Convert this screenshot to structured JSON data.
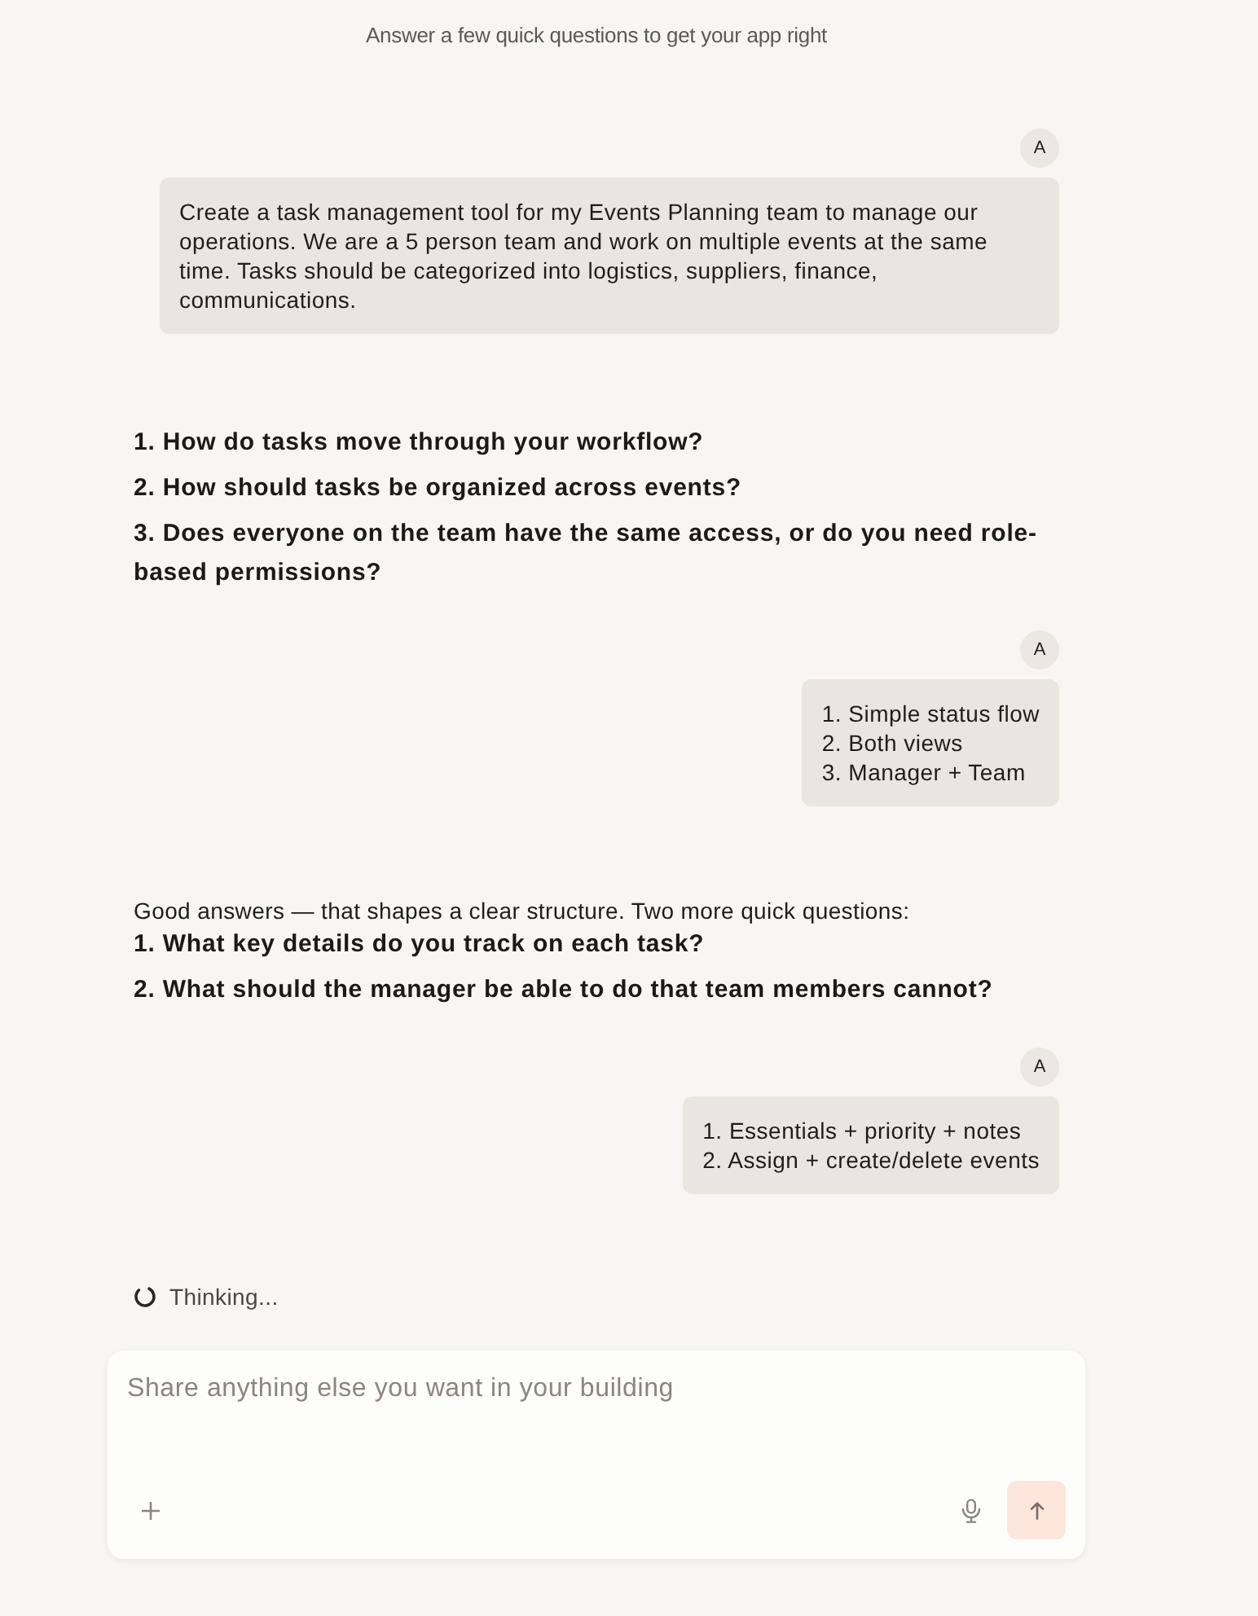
{
  "header": {
    "subtitle": "Answer a few quick questions to get your app right"
  },
  "messages": [
    {
      "kind": "user",
      "avatar": "A",
      "lines": [
        "Create a task management tool for my Events Planning team to manage our operations. We are a 5 person team and work on multiple events at the same time. Tasks should be categorized into logistics, suppliers, finance, communications."
      ]
    },
    {
      "kind": "assistant",
      "questions": [
        "1. How do tasks move through your workflow?",
        "2. How should tasks be organized across events?",
        "3. Does everyone on the team have the same access, or do you need role-based permissions?"
      ]
    },
    {
      "kind": "user",
      "avatar": "A",
      "lines": [
        "1. Simple status flow",
        "2. Both views",
        "3. Manager + Team"
      ]
    },
    {
      "kind": "assistant",
      "intro": "Good answers — that shapes a clear structure. Two more quick questions:",
      "questions": [
        "1. What key details do you track on each task?",
        "2. What should the manager be able to do that team members cannot?"
      ]
    },
    {
      "kind": "user",
      "avatar": "A",
      "lines": [
        "1. Essentials + priority + notes",
        "2. Assign + create/delete events"
      ]
    }
  ],
  "status": {
    "text": "Thinking..."
  },
  "composer": {
    "placeholder": "Share anything else you want in your building"
  }
}
